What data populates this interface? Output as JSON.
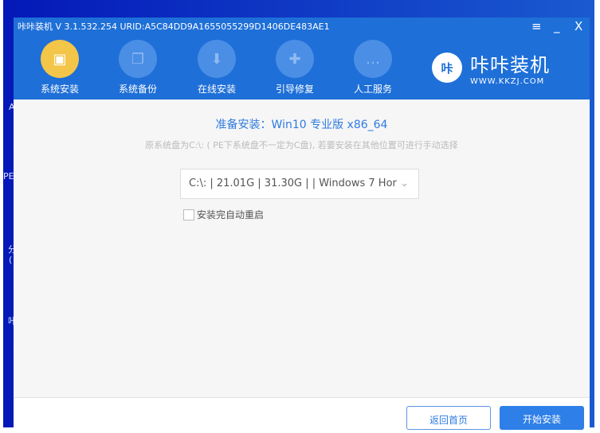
{
  "desktop": {
    "labels": [
      "A",
      "PE",
      "分",
      "(",
      "咔"
    ]
  },
  "window": {
    "title": "咔咔装机 V 3.1.532.254 URID:A5C84DD9A1655055299D1406DE483AE1",
    "menu": "≡",
    "minimize": "_",
    "close": "X"
  },
  "nav": [
    {
      "label": "系统安装",
      "icon": "package-icon"
    },
    {
      "label": "系统备份",
      "icon": "copy-icon"
    },
    {
      "label": "在线安装",
      "icon": "download-icon"
    },
    {
      "label": "引导修复",
      "icon": "toolbox-icon"
    },
    {
      "label": "人工服务",
      "icon": "chat-icon"
    }
  ],
  "logo": {
    "badge": "咔",
    "name": "咔咔装机",
    "url": "WWW.KKZJ.COM"
  },
  "main": {
    "heading": "准备安装：Win10 专业版 x86_64",
    "hint": "原系统盘为C:\\: ( PE下系统盘不一定为C盘), 若要安装在其他位置可进行手动选择",
    "select_value": "C:\\: | 21.01G | 31.30G |  | Windows 7 Hor",
    "checkbox_label": "安装完自动重启",
    "checkbox_checked": false
  },
  "footer": {
    "back": "返回首页",
    "start": "开始安装"
  }
}
